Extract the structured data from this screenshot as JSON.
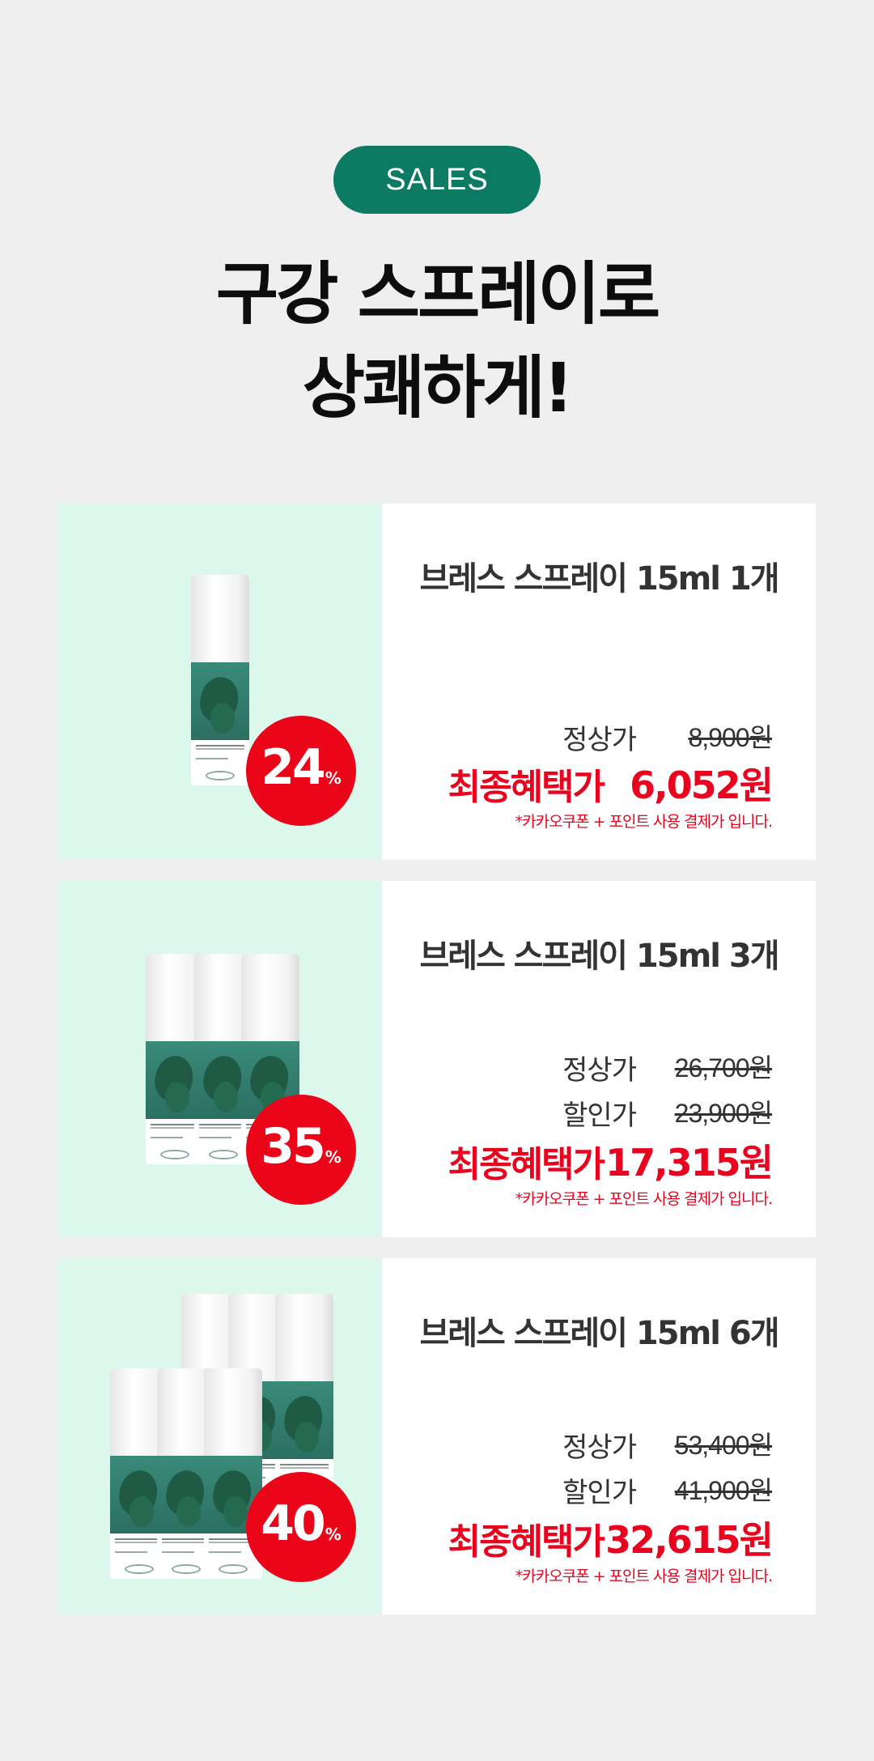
{
  "badge": "SALES",
  "headline": {
    "line1": "구강 스프레이로",
    "line2": "상쾌하게!"
  },
  "products": [
    {
      "title": "브레스 스프레이 15ml 1개",
      "discount": "24",
      "discount_unit": "%",
      "regular_label": "정상가",
      "regular_price": "8,900원",
      "final_label": "최종혜택가",
      "final_price": "6,052원",
      "note": "*카카오쿠폰 + 포인트 사용 결제가 입니다."
    },
    {
      "title": "브레스 스프레이 15ml 3개",
      "discount": "35",
      "discount_unit": "%",
      "regular_label": "정상가",
      "regular_price": "26,700원",
      "sale_label": "할인가",
      "sale_price": "23,900원",
      "final_label": "최종혜택가",
      "final_price": "17,315원",
      "note": "*카카오쿠폰 + 포인트 사용 결제가 입니다."
    },
    {
      "title": "브레스 스프레이 15ml 6개",
      "discount": "40",
      "discount_unit": "%",
      "regular_label": "정상가",
      "regular_price": "53,400원",
      "sale_label": "할인가",
      "sale_price": "41,900원",
      "final_label": "최종혜택가",
      "final_price": "32,615원",
      "note": "*카카오쿠폰 + 포인트 사용 결제가 입니다."
    }
  ],
  "colors": {
    "brand": "#0d7a63",
    "accent_red": "#e8041e",
    "image_bg": "#dcf7ec",
    "page_bg": "#efefef"
  }
}
